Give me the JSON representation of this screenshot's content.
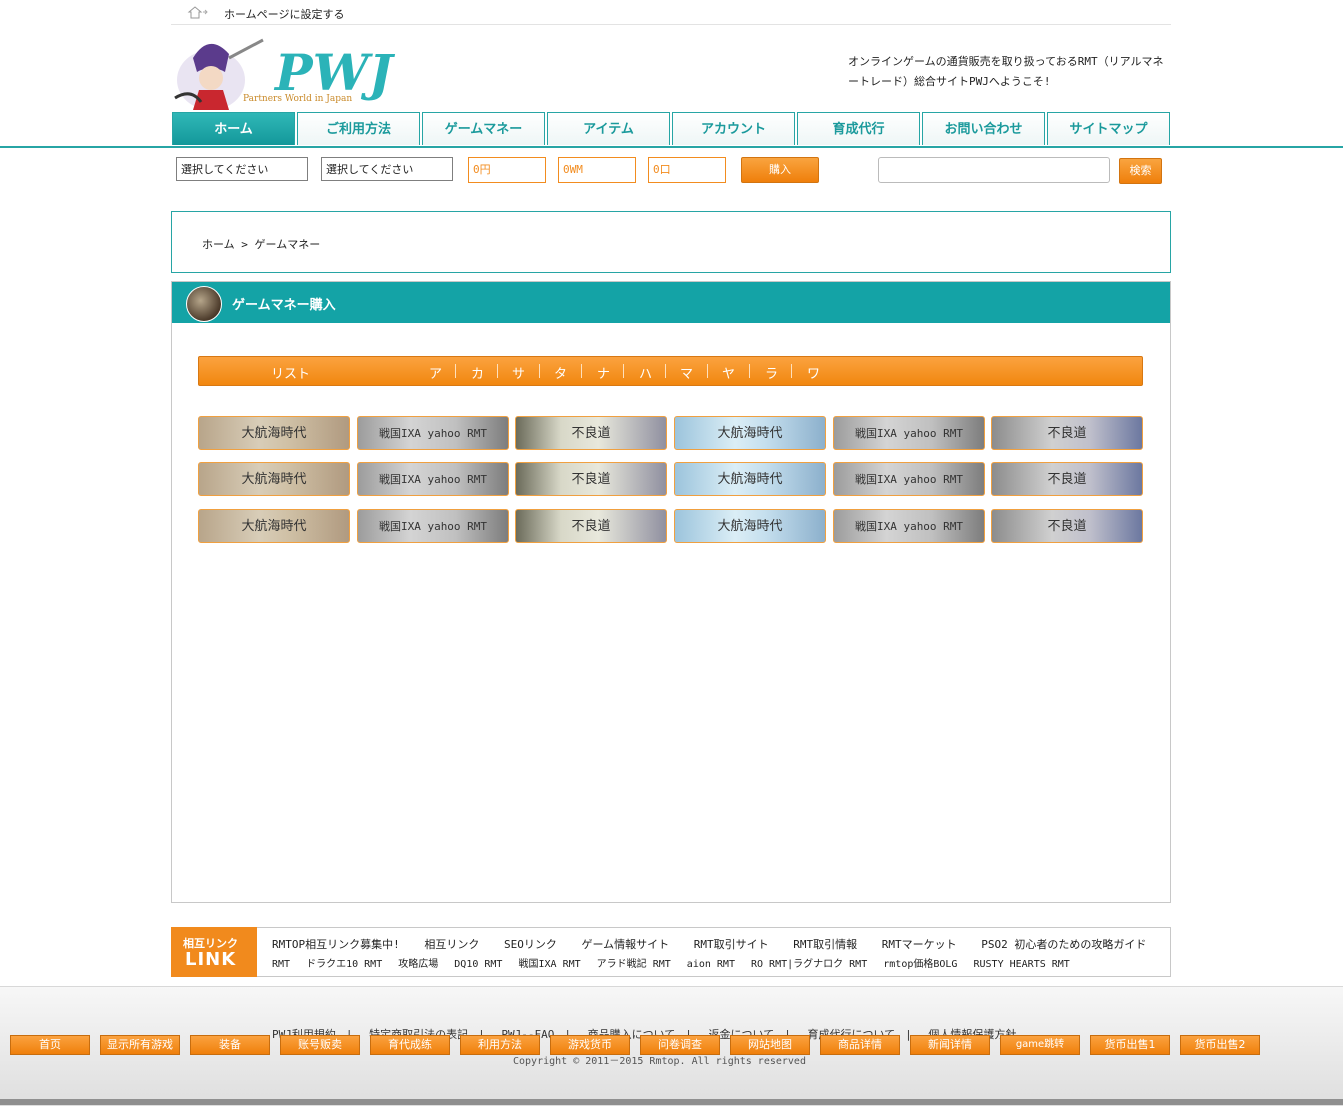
{
  "topbar": {
    "homepage_link": "ホームページに設定する"
  },
  "header": {
    "logo_text": "PWJ",
    "logo_sub": "Partners World in Japan",
    "welcome": "オンラインゲームの通貨販売を取り扱っておるRMT（リアルマネートレード）総合サイトPWJへようこそ!"
  },
  "nav": [
    {
      "label": "ホーム",
      "active": true
    },
    {
      "label": "ご利用方法"
    },
    {
      "label": "ゲームマネー"
    },
    {
      "label": "アイテム"
    },
    {
      "label": "アカウント"
    },
    {
      "label": "育成代行"
    },
    {
      "label": "お問い合わせ"
    },
    {
      "label": "サイトマップ"
    }
  ],
  "search": {
    "select1": "選択してください",
    "select2": "選択してください",
    "price": "0円",
    "amount": "0WM",
    "quantity": "0口",
    "buy_label": "購入",
    "search_label": "検索"
  },
  "breadcrumb": "ホーム > ゲームマネー",
  "main": {
    "title": "ゲームマネー購入",
    "list_title": "リスト",
    "kana": [
      "ア",
      "カ",
      "サ",
      "タ",
      "ナ",
      "ハ",
      "マ",
      "ヤ",
      "ラ",
      "ワ"
    ],
    "games": [
      [
        "大航海時代",
        "戦国IXA yahoo RMT",
        "不良道",
        "大航海時代",
        "戦国IXA yahoo RMT",
        "不良道"
      ],
      [
        "大航海時代",
        "戦国IXA yahoo RMT",
        "不良道",
        "大航海時代",
        "戦国IXA yahoo RMT",
        "不良道"
      ],
      [
        "大航海時代",
        "戦国IXA yahoo RMT",
        "不良道",
        "大航海時代",
        "戦国IXA yahoo RMT",
        "不良道"
      ]
    ]
  },
  "links": {
    "badge_top": "相互リンク",
    "badge_bottom": "LINK",
    "row1": [
      "RMTOP相互リンク募集中!",
      "相互リンク",
      "SEOリンク",
      "ゲーム情報サイト",
      "RMT取引サイト",
      "RMT取引情報",
      "RMTマーケット",
      "PSO2 初心者のための攻略ガイド"
    ],
    "row2": [
      "RMT",
      "ドラクエ10 RMT",
      "攻略広場",
      "DQ10 RMT",
      "戦国IXA RMT",
      "アラド戦記 RMT",
      "aion RMT",
      "RO RMT|ラグナロク RMT",
      "rmtop価格BOLG",
      "RUSTY HEARTS RMT"
    ]
  },
  "footer": {
    "links": [
      "PWJ利用規約",
      "特定商取引法の表記",
      "PWJ--FAQ",
      "商品購入について",
      "返金について",
      "育成代行について",
      "個人情報保護方針"
    ],
    "copyright": "Copyright © 2011－2015 Rmtop. All rights reserved",
    "buttons": [
      "首页",
      "显示所有游戏",
      "装备",
      "账号贩卖",
      "育代成练",
      "利用方法",
      "游戏货币",
      "问卷调查",
      "网站地图",
      "商品详情",
      "新闻详情",
      "game跳转",
      "货币出售1",
      "货币出售2"
    ]
  }
}
